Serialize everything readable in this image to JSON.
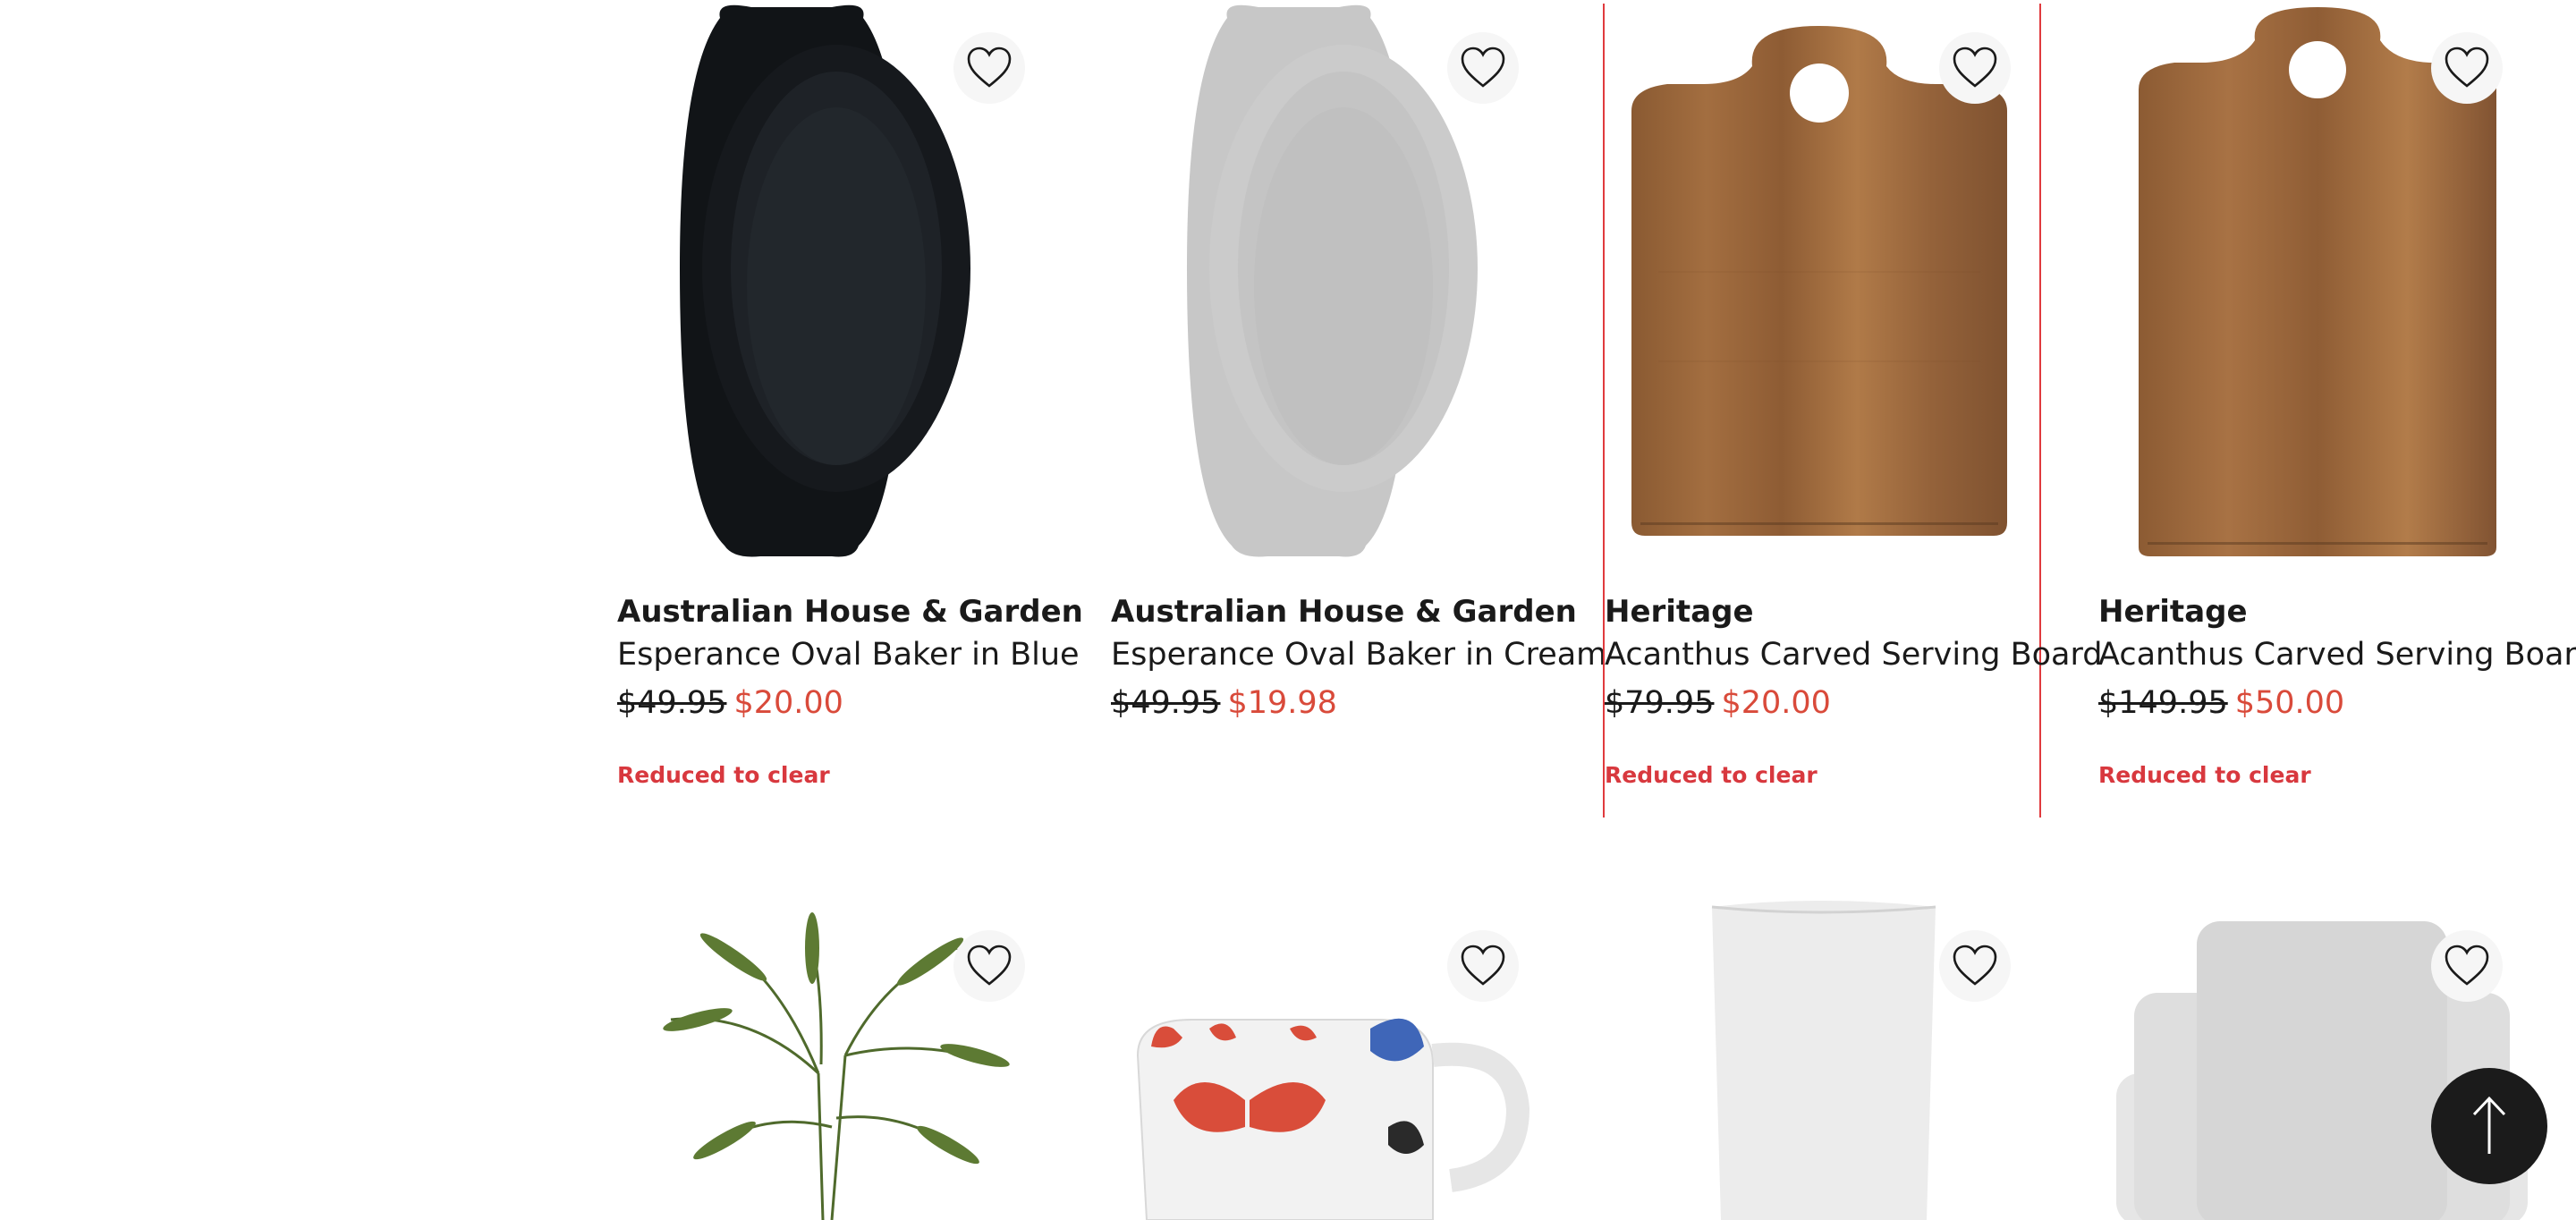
{
  "products": [
    {
      "brand": "Australian House & Garden",
      "name": "Esperance Oval Baker in Blue",
      "was_price": "$49.95",
      "now_price": "$20.00",
      "badge": "Reduced to clear",
      "image": "black-oval-baker",
      "wishlist_icon": "heart-outline-icon"
    },
    {
      "brand": "Australian House & Garden",
      "name": "Esperance Oval Baker in Cream",
      "was_price": "$49.95",
      "now_price": "$19.98",
      "badge": "",
      "image": "grey-oval-baker",
      "wishlist_icon": "heart-outline-icon"
    },
    {
      "brand": "Heritage",
      "name": "Acanthus Carved Serving Board",
      "was_price": "$79.95",
      "now_price": "$20.00",
      "badge": "Reduced to clear",
      "image": "wooden-serving-board",
      "wishlist_icon": "heart-outline-icon"
    },
    {
      "brand": "Heritage",
      "name": "Acanthus Carved Serving Board",
      "was_price": "$149.95",
      "now_price": "$50.00",
      "badge": "Reduced to clear",
      "image": "wooden-serving-board-large",
      "wishlist_icon": "heart-outline-icon"
    },
    {
      "image": "potted-palm-plant",
      "wishlist_icon": "heart-outline-icon"
    },
    {
      "image": "butterfly-mug",
      "wishlist_icon": "heart-outline-icon"
    },
    {
      "image": "white-cylinder-vase",
      "wishlist_icon": "heart-outline-icon"
    },
    {
      "image": "white-stacked-trays",
      "wishlist_icon": "heart-outline-icon"
    }
  ],
  "colors": {
    "sale_price": "#d94a3a",
    "badge": "#d8383e",
    "highlight_border": "#e03a3e",
    "scroll_button": "#1b1b1b"
  },
  "scroll_top_icon": "arrow-up-icon"
}
